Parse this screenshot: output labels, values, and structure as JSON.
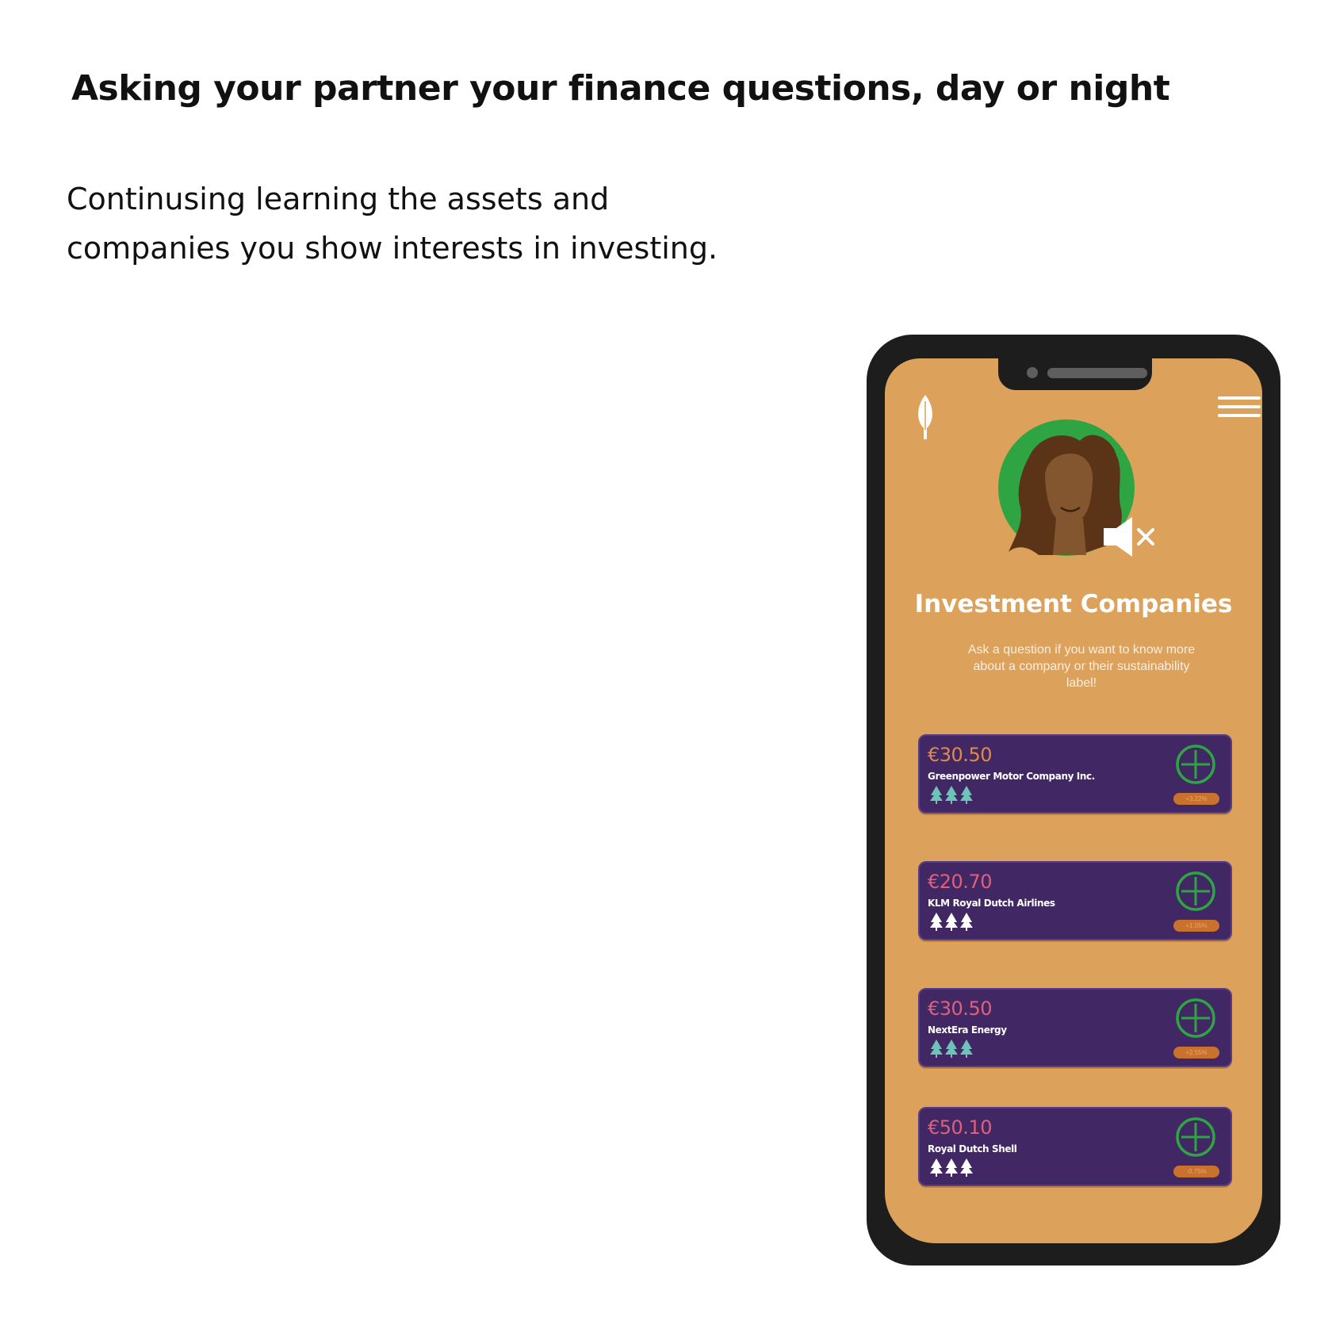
{
  "page": {
    "headline": "Asking your partner your finance questions, day or night",
    "subtext_line1": "Continusing learning the assets and",
    "subtext_line2": "companies you show interests in investing."
  },
  "app": {
    "title": "Investment Companies",
    "description": "Ask a question if you want to know more about a company or their sustainability label!",
    "icons": {
      "logo": "leaf-icon",
      "menu": "hamburger-menu-icon",
      "mute": "speaker-muted-icon",
      "add": "plus-circle-icon",
      "rating": "tree-icon"
    },
    "colors": {
      "background": "#dca15a",
      "card": "#412865",
      "accent_green": "#2fa443",
      "badge": "#c8722d"
    }
  },
  "companies": [
    {
      "price": "€30.50",
      "name": "Greenpower Motor Company Inc.",
      "change": "+3.22%",
      "price_color": "#e08a46",
      "tree_color": "#6fc2b8"
    },
    {
      "price": "€20.70",
      "name": "KLM Royal Dutch Airlines",
      "change": "+1.05%",
      "price_color": "#e0607a",
      "tree_color": "#ffffff"
    },
    {
      "price": "€30.50",
      "name": "NextEra Energy",
      "change": "+2.55%",
      "price_color": "#e0607a",
      "tree_color": "#6fc2b8"
    },
    {
      "price": "€50.10",
      "name": "Royal Dutch Shell",
      "change": "-0.75%",
      "price_color": "#e0607a",
      "tree_color": "#ffffff"
    }
  ]
}
